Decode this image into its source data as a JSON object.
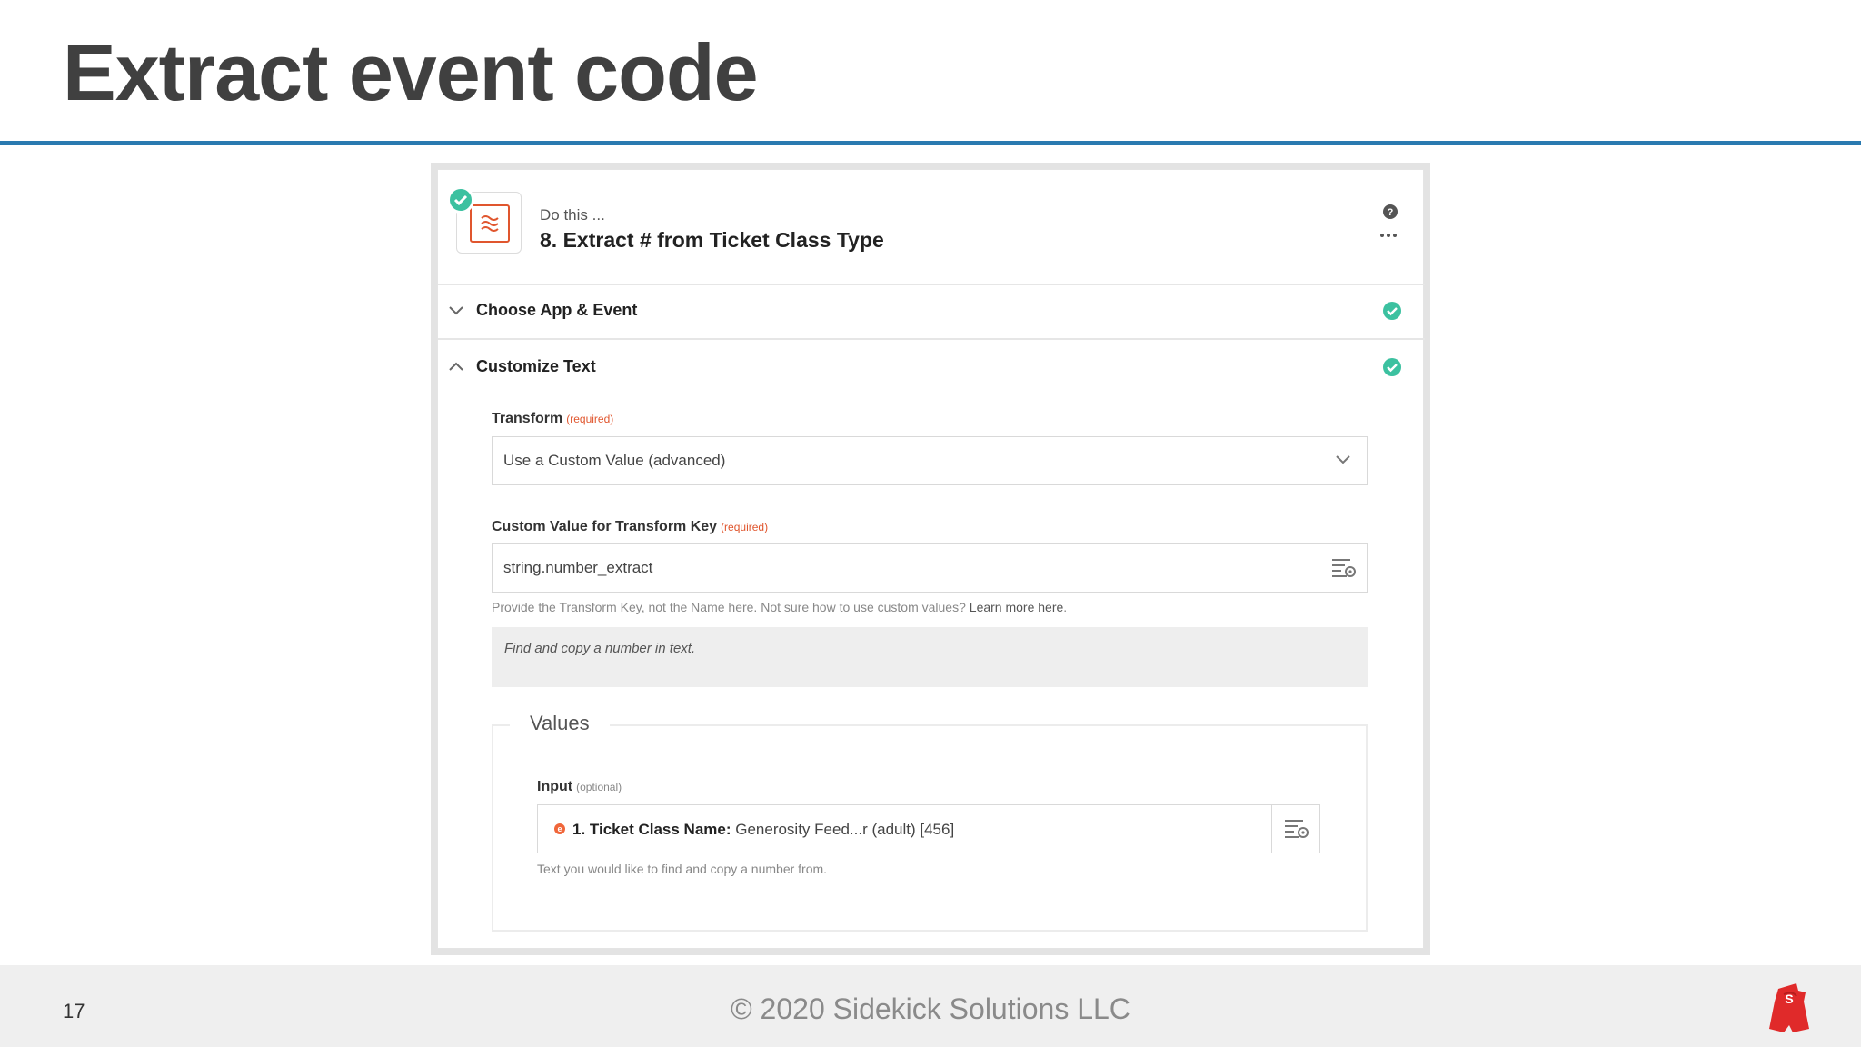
{
  "slide": {
    "title": "Extract event code",
    "page_number": "17",
    "copyright": "© 2020 Sidekick Solutions LLC"
  },
  "step": {
    "prefix": "Do this ...",
    "title": "8. Extract # from Ticket Class Type"
  },
  "sections": {
    "choose_app": "Choose App & Event",
    "customize": "Customize Text"
  },
  "transform": {
    "label": "Transform",
    "required": "(required)",
    "value": "Use a Custom Value (advanced)"
  },
  "custom_value": {
    "label": "Custom Value for Transform Key",
    "required": "(required)",
    "value": "string.number_extract",
    "hint": "Provide the Transform Key, not the Name here. Not sure how to use custom values?",
    "hint_link": "Learn more here",
    "description": "Find and copy a number in text."
  },
  "values": {
    "legend": "Values",
    "input_label": "Input",
    "optional": "(optional)",
    "token_label": "1. Ticket Class Name:",
    "token_value": "Generosity Feed...r (adult) [456]",
    "hint": "Text you would like to find and copy a number from."
  },
  "colors": {
    "accent_rule": "#2a7ab0",
    "success": "#3cc1a0",
    "required": "#e0562e",
    "logo": "#e02a2a"
  },
  "icons": [
    "check-circle-icon",
    "formatter-icon",
    "help-icon",
    "more-icon",
    "chevron-down-icon",
    "chevron-up-icon",
    "field-options-icon",
    "sidekick-logo"
  ]
}
